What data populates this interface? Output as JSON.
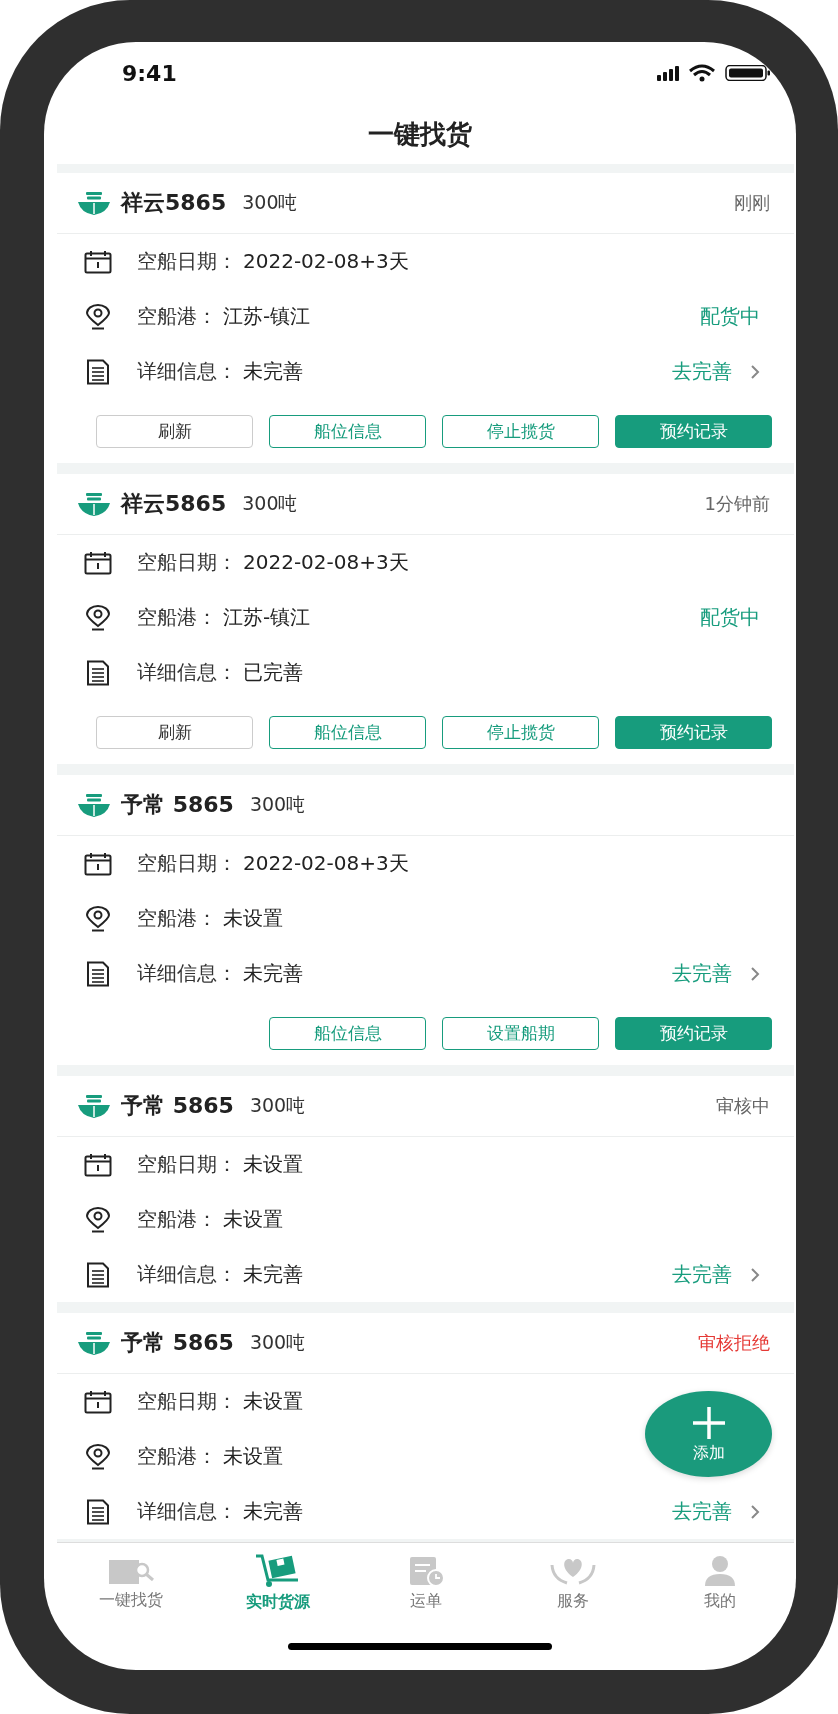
{
  "status_bar": {
    "time": "9:41"
  },
  "header": {
    "title": "一键找货"
  },
  "cards": [
    {
      "name": "祥云5865",
      "tonnage": "300吨",
      "badge": {
        "text": "刚刚",
        "kind": "time"
      },
      "date": {
        "label": "空船日期：",
        "value": "2022-02-08+3天"
      },
      "port": {
        "label": "空船港：",
        "value": "江苏-镇江",
        "status": "配货中"
      },
      "details": {
        "label": "详细信息：",
        "value": "未完善",
        "action": "去完善"
      },
      "buttons": [
        {
          "label": "刷新",
          "kind": "plain"
        },
        {
          "label": "船位信息",
          "kind": "outline"
        },
        {
          "label": "停止揽货",
          "kind": "outline"
        },
        {
          "label": "预约记录",
          "kind": "primary"
        }
      ]
    },
    {
      "name": "祥云5865",
      "tonnage": "300吨",
      "badge": {
        "text": "1分钟前",
        "kind": "time"
      },
      "date": {
        "label": "空船日期：",
        "value": "2022-02-08+3天"
      },
      "port": {
        "label": "空船港：",
        "value": "江苏-镇江",
        "status": "配货中"
      },
      "details": {
        "label": "详细信息：",
        "value": "已完善"
      },
      "buttons": [
        {
          "label": "刷新",
          "kind": "plain"
        },
        {
          "label": "船位信息",
          "kind": "outline"
        },
        {
          "label": "停止揽货",
          "kind": "outline"
        },
        {
          "label": "预约记录",
          "kind": "primary"
        }
      ]
    },
    {
      "name": "予常 5865",
      "tonnage": "300吨",
      "date": {
        "label": "空船日期：",
        "value": "2022-02-08+3天"
      },
      "port": {
        "label": "空船港：",
        "value": "未设置"
      },
      "details": {
        "label": "详细信息：",
        "value": "未完善",
        "action": "去完善"
      },
      "buttons": [
        {
          "label": "船位信息",
          "kind": "outline"
        },
        {
          "label": "设置船期",
          "kind": "outline"
        },
        {
          "label": "预约记录",
          "kind": "primary"
        }
      ]
    },
    {
      "name": "予常 5865",
      "tonnage": "300吨",
      "badge": {
        "text": "审核中",
        "kind": "reviewing"
      },
      "date": {
        "label": "空船日期：",
        "value": "未设置"
      },
      "port": {
        "label": "空船港：",
        "value": "未设置"
      },
      "details": {
        "label": "详细信息：",
        "value": "未完善",
        "action": "去完善"
      }
    },
    {
      "name": "予常 5865",
      "tonnage": "300吨",
      "badge": {
        "text": "审核拒绝",
        "kind": "rejected"
      },
      "date": {
        "label": "空船日期：",
        "value": "未设置"
      },
      "port": {
        "label": "空船港：",
        "value": "未设置"
      },
      "details": {
        "label": "详细信息：",
        "value": "未完善",
        "action": "去完善"
      }
    }
  ],
  "fab": {
    "label": "添加"
  },
  "tabs": [
    {
      "label": "一键找货",
      "selected": false
    },
    {
      "label": "实时货源",
      "selected": true
    },
    {
      "label": "运单",
      "selected": false
    },
    {
      "label": "服务",
      "selected": false
    },
    {
      "label": "我的",
      "selected": false
    }
  ]
}
